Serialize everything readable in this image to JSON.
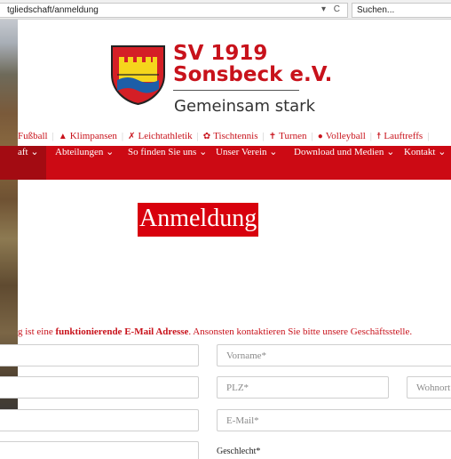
{
  "browser": {
    "url": "tgliedschaft/anmeldung",
    "url_controls": [
      "▾",
      "C"
    ],
    "search_placeholder": "Suchen..."
  },
  "header": {
    "club_name_line1": "SV 1919",
    "club_name_line2": "Sonsbeck e.V.",
    "slogan": "Gemeinsam stark",
    "crest_colors": {
      "red": "#d41f26",
      "yellow": "#f5d61c",
      "blue": "#1d5ea8"
    }
  },
  "sports": [
    {
      "label": "Fußball",
      "icon": ""
    },
    {
      "label": "Klimpansen",
      "icon": "mountain-icon"
    },
    {
      "label": "Leichtathletik",
      "icon": "runner-icon"
    },
    {
      "label": "Tischtennis",
      "icon": "table-tennis-icon"
    },
    {
      "label": "Turnen",
      "icon": "gymnast-icon"
    },
    {
      "label": "Volleyball",
      "icon": "volleyball-icon"
    },
    {
      "label": "Lauftreffs",
      "icon": "jogger-icon"
    }
  ],
  "nav": {
    "items": [
      {
        "label": "aft"
      },
      {
        "label": "Abteilungen"
      },
      {
        "label": "So finden Sie uns"
      },
      {
        "label": "Unser Verein"
      },
      {
        "label": "Download und Medien"
      },
      {
        "label": "Kontakt"
      }
    ],
    "chevron": "⌄",
    "bg_color": "#cc0a14"
  },
  "page_title": "Anmeldung",
  "notice": {
    "prefix": "g ist eine ",
    "bold": "funktionierende E-Mail Adresse",
    "suffix": ". Ansonsten kontaktieren Sie bitte unsere Geschäftsstelle."
  },
  "form": {
    "vorname_placeholder": "Vorname*",
    "plz_placeholder": "PLZ*",
    "wohnort_placeholder": "Wohnort*",
    "email_placeholder": "E-Mail*",
    "gender_label": "Geschlecht*"
  }
}
